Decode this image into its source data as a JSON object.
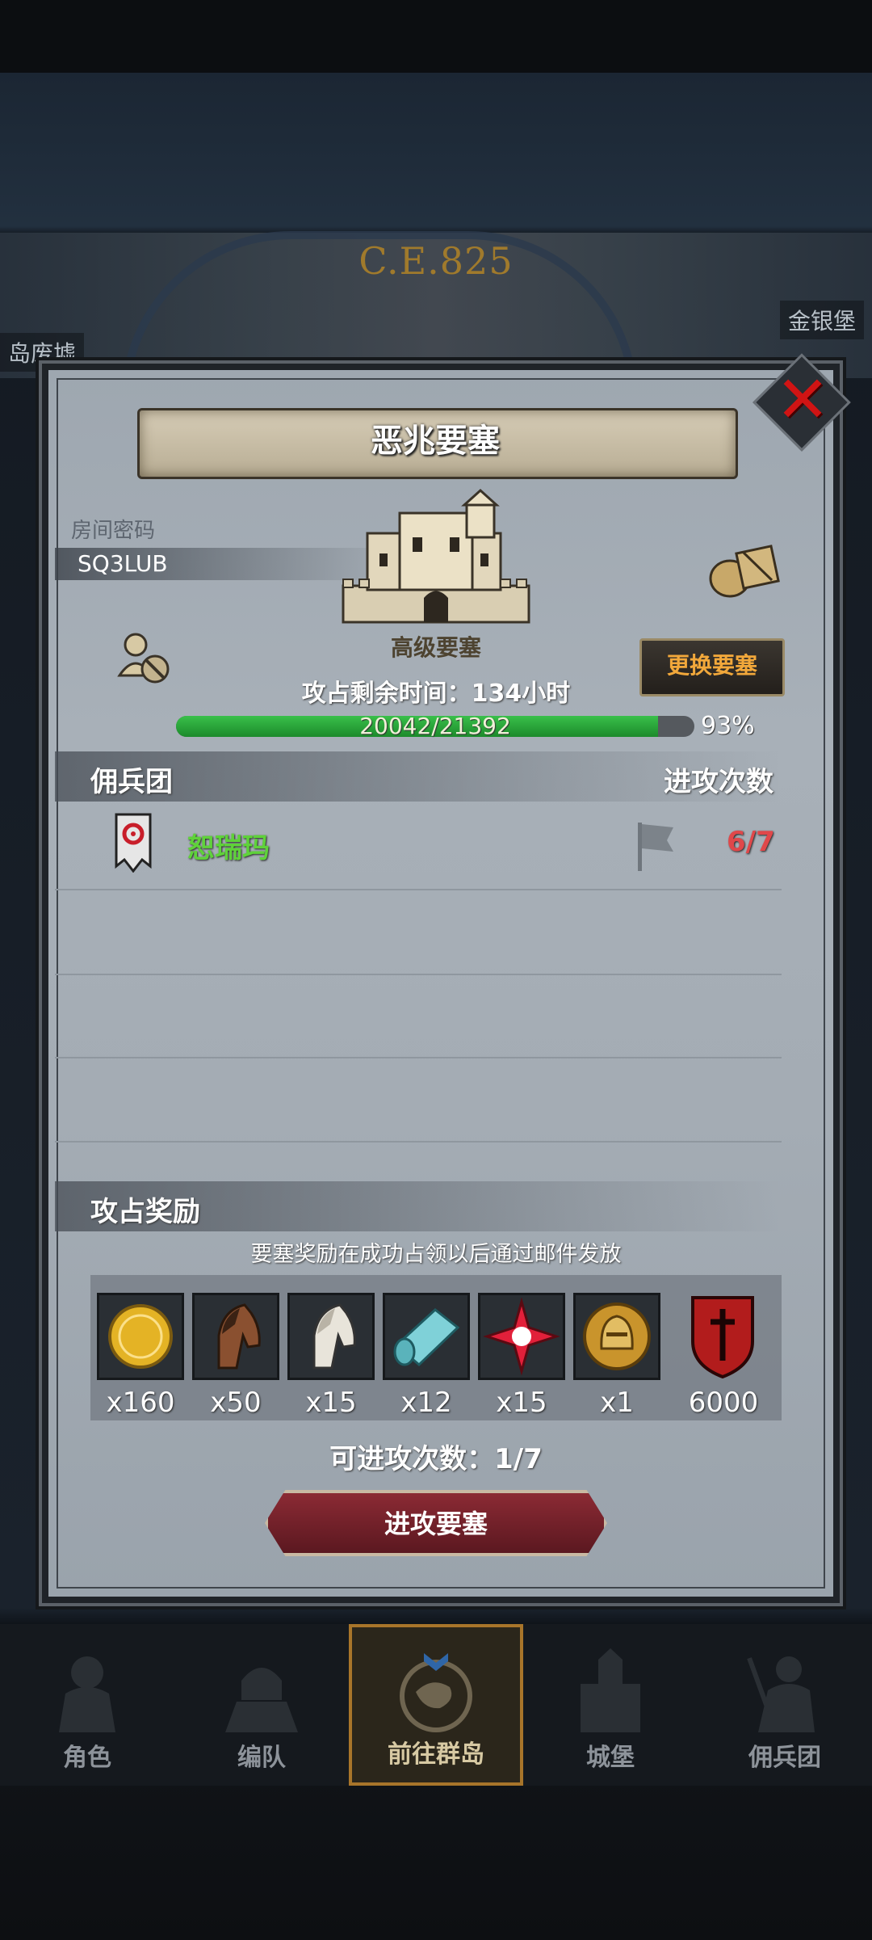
{
  "background": {
    "era": "C.E.825",
    "left_location": "岛废墟",
    "right_location": "金银堡"
  },
  "dialog": {
    "title": "恶兆要塞",
    "room_label": "房间密码",
    "room_code": "SQ3LUB",
    "fortress_type": "高级要塞",
    "change_button": "更换要塞",
    "time_remaining": "攻占剩余时间：134小时",
    "progress": {
      "current": 20042,
      "total": 21392,
      "text": "20042/21392",
      "percent_text": "93%",
      "fraction": 0.93
    },
    "mercenary_header": "佣兵团",
    "attack_count_header": "进攻次数",
    "mercenaries": [
      {
        "name": "恕瑞玛",
        "attacks": "6/7"
      }
    ],
    "reward_header": "攻占奖励",
    "reward_note": "要塞奖励在成功占领以后通过邮件发放",
    "rewards": [
      {
        "icon": "gold-coin-icon",
        "count": "x160"
      },
      {
        "icon": "brown-horse-icon",
        "count": "x50"
      },
      {
        "icon": "white-horse-icon",
        "count": "x15"
      },
      {
        "icon": "cloth-roll-icon",
        "count": "x12"
      },
      {
        "icon": "red-crystal-icon",
        "count": "x15"
      },
      {
        "icon": "helmet-medal-icon",
        "count": "x1"
      },
      {
        "icon": "red-shield-icon",
        "count": "6000"
      }
    ],
    "remaining_attacks": "可进攻次数：1/7",
    "attack_button": "进攻要塞"
  },
  "nav": {
    "items": [
      {
        "label": "角色"
      },
      {
        "label": "编队"
      },
      {
        "label": "前往群岛",
        "active": true
      },
      {
        "label": "城堡"
      },
      {
        "label": "佣兵团"
      }
    ]
  },
  "colors": {
    "accent_gold": "#f2a83b",
    "progress_green": "#39c04a",
    "merc_green": "#5fd23a",
    "count_red": "#e0484a",
    "button_red": "#8b2a34"
  }
}
